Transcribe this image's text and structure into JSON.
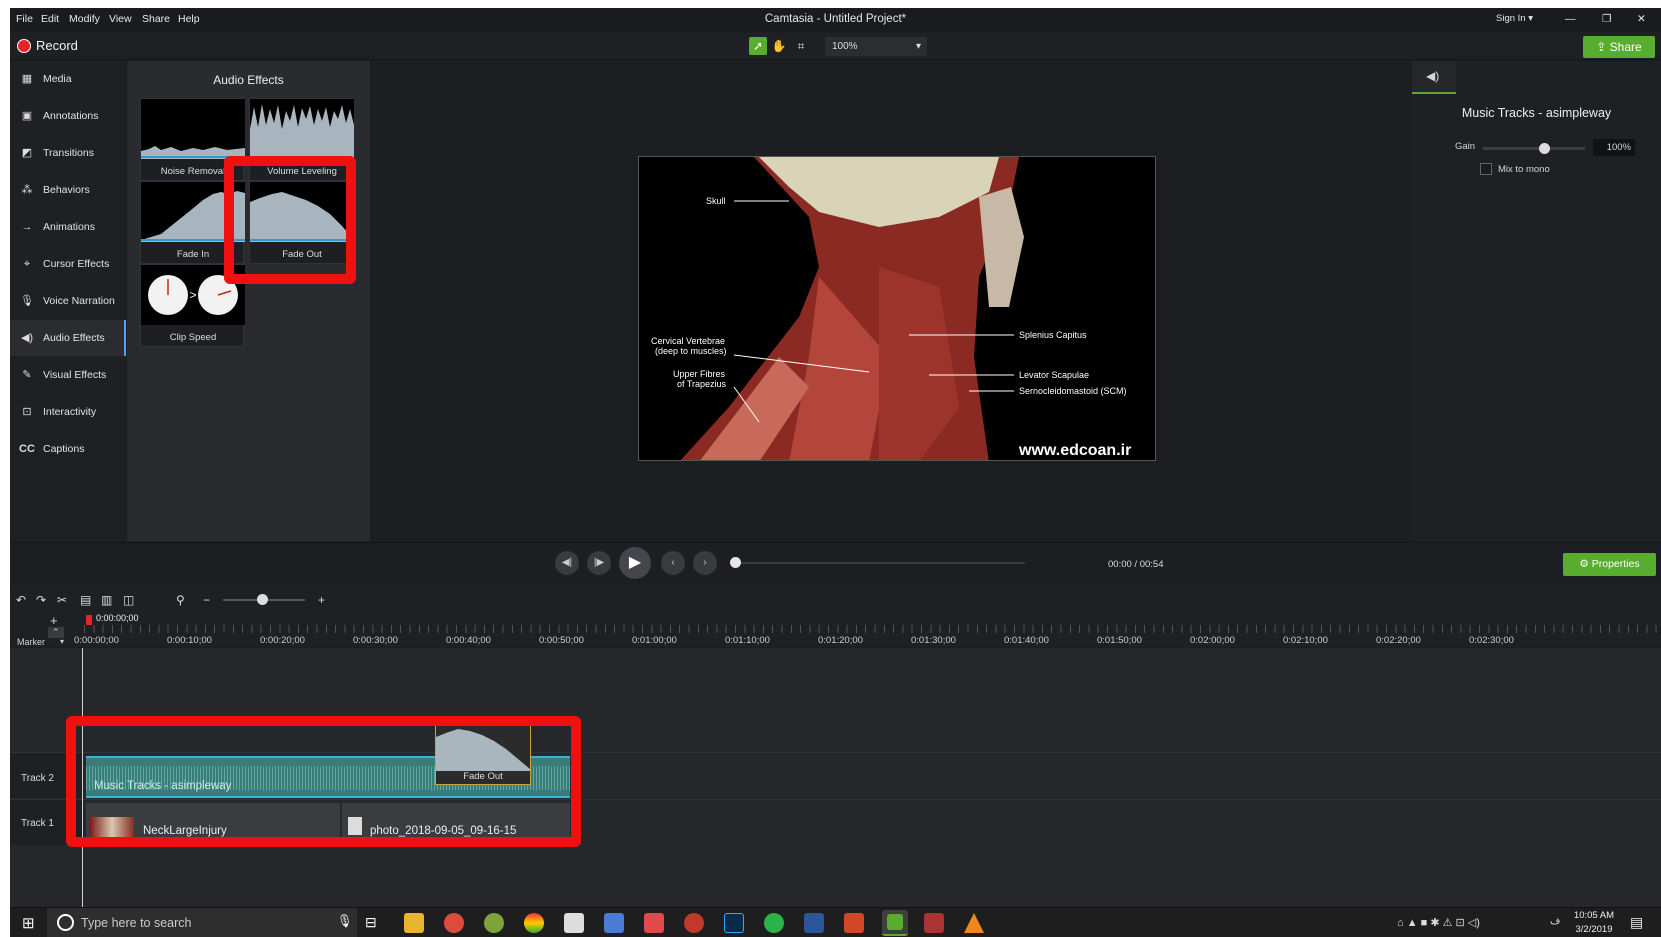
{
  "window": {
    "title": "Camtasia - Untitled Project*",
    "sign_in": "Sign In ▾",
    "min": "—",
    "restore": "❐",
    "close": "✕"
  },
  "menu": [
    "File",
    "Edit",
    "Modify",
    "View",
    "Share",
    "Help"
  ],
  "toolbar": {
    "record_label": "Record",
    "zoom": "100%",
    "share_label": "Share"
  },
  "nav": [
    {
      "label": "Media",
      "icon": "film-icon"
    },
    {
      "label": "Annotations",
      "icon": "annotation-icon"
    },
    {
      "label": "Transitions",
      "icon": "transition-icon"
    },
    {
      "label": "Behaviors",
      "icon": "behaviors-icon"
    },
    {
      "label": "Animations",
      "icon": "animation-arrow-icon"
    },
    {
      "label": "Cursor Effects",
      "icon": "cursor-icon"
    },
    {
      "label": "Voice Narration",
      "icon": "microphone-icon"
    },
    {
      "label": "Audio Effects",
      "icon": "speaker-icon"
    },
    {
      "label": "Visual Effects",
      "icon": "magic-wand-icon"
    },
    {
      "label": "Interactivity",
      "icon": "interactivity-icon"
    },
    {
      "label": "Captions",
      "icon": "cc-icon"
    }
  ],
  "effects": {
    "title": "Audio Effects",
    "items": [
      "Noise Removal",
      "Volume Leveling",
      "Fade In",
      "Fade Out",
      "Clip Speed"
    ]
  },
  "preview": {
    "labels": {
      "skull": "Skull",
      "cervical": "Cervical Vertebrae",
      "cervical2": "(deep to muscles)",
      "trap": "Upper Fibres",
      "trap2": "of Trapezius",
      "splenius": "Splenius Capitus",
      "levator": "Levator Scapulae",
      "scm": "Sernocleidomastoid (SCM)"
    },
    "watermark": "www.edcoan.ir"
  },
  "properties": {
    "clip_title": "Music Tracks - asimpleway",
    "gain_label": "Gain",
    "gain_value": "100%",
    "gain_level": 0.6,
    "mono_label": "Mix to mono",
    "mono_checked": false,
    "button_label": "Properties"
  },
  "playback": {
    "current": "00:00",
    "separator": "/",
    "duration": "00:54",
    "progress": 0
  },
  "timeline": {
    "playhead": "0:00:00;00",
    "marker_label": "Marker",
    "ticks": [
      "0:00:00;00",
      "0:00:10;00",
      "0:00:20;00",
      "0:00:30;00",
      "0:00:40;00",
      "0:00:50;00",
      "0:01:00;00",
      "0:01:10;00",
      "0:01:20;00",
      "0:01:30;00",
      "0:01:40;00",
      "0:01:50;00",
      "0:02:00;00",
      "0:02:10;00",
      "0:02:20;00",
      "0:02:30;00"
    ],
    "tracks": [
      {
        "name": "Track 2",
        "clip": "Music Tracks - asimpleway",
        "effect": "Fade Out"
      },
      {
        "name": "Track 1",
        "clips": [
          "NeckLargeInjury",
          "photo_2018-09-05_09-16-15"
        ]
      }
    ]
  },
  "taskbar": {
    "search_placeholder": "Type here to search",
    "time": "10:05 AM",
    "date": "3/2/2019",
    "lang": "ف"
  },
  "colors": {
    "accent_green": "#58ad2f",
    "highlight_red": "#f01010",
    "record_red": "#e8232a",
    "audio_teal": "#3a8a85"
  }
}
